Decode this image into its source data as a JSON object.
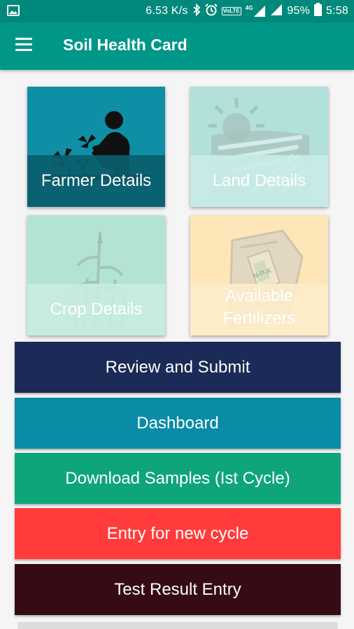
{
  "status_bar": {
    "speed": "6.53 K/s",
    "network_badge": "VoLTE",
    "network_type": "4G",
    "battery": "95%",
    "time": "5:58",
    "icons": [
      "image-icon",
      "bluetooth-icon",
      "alarm-icon",
      "signal-icon",
      "battery-icon"
    ]
  },
  "app_bar": {
    "title": "Soil Health Card",
    "menu_icon": "hamburger-menu-icon"
  },
  "tiles": [
    {
      "label": "Farmer Details",
      "icon": "farmer-planting-icon",
      "color": "#0e8fa6"
    },
    {
      "label": "Land Details",
      "icon": "sun-field-icon",
      "color": "#b2e1dc"
    },
    {
      "label": "Crop Details",
      "icon": "corn-plant-icon",
      "color": "#b3e4d3"
    },
    {
      "label": "Available\nFertilizers",
      "icon": "npk-fertilizer-bag-icon",
      "color": "#fde6b8",
      "bag_text": "N-P-K"
    }
  ],
  "buttons": [
    {
      "label": "Review and Submit",
      "color": "#1b2a56"
    },
    {
      "label": "Dashboard",
      "color": "#0a8ba6"
    },
    {
      "label": "Download Samples (Ist Cycle)",
      "color": "#0ea57a"
    },
    {
      "label": "Entry for new cycle",
      "color": "#ff3b3b"
    },
    {
      "label": "Test Result Entry",
      "color": "#360b14"
    }
  ]
}
